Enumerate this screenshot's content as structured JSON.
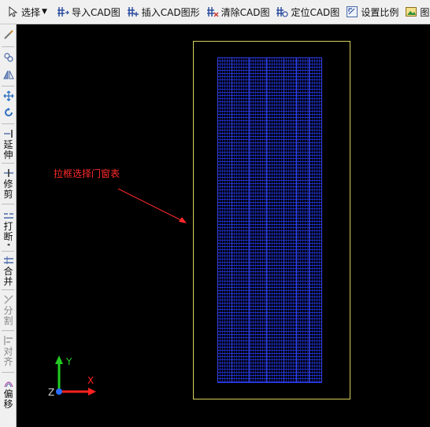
{
  "toolbar": {
    "select_label": "选择",
    "import_cad_label": "导入CAD图",
    "insert_cad_label": "插入CAD图形",
    "clear_cad_label": "清除CAD图",
    "locate_cad_label": "定位CAD图",
    "set_scale_label": "设置比例",
    "image_manage_label": "图片管"
  },
  "sidebar": {
    "extend_label": "延伸",
    "trim_label": "修剪",
    "break_label": "打断",
    "merge_label": "合并",
    "split_label": "分割",
    "align_label": "对齐",
    "offset_label": "偏移"
  },
  "canvas": {
    "annotation_text": "拉框选择门窗表",
    "axis_y_label": "Y",
    "axis_x_label": "X",
    "axis_z_label": "Z",
    "colors": {
      "background": "#000000",
      "frame": "#d8cf5a",
      "table_lines": "#2f43ff",
      "annotation": "#ff2a2a",
      "axis_x": "#ff2020",
      "axis_y": "#22cc22"
    }
  }
}
